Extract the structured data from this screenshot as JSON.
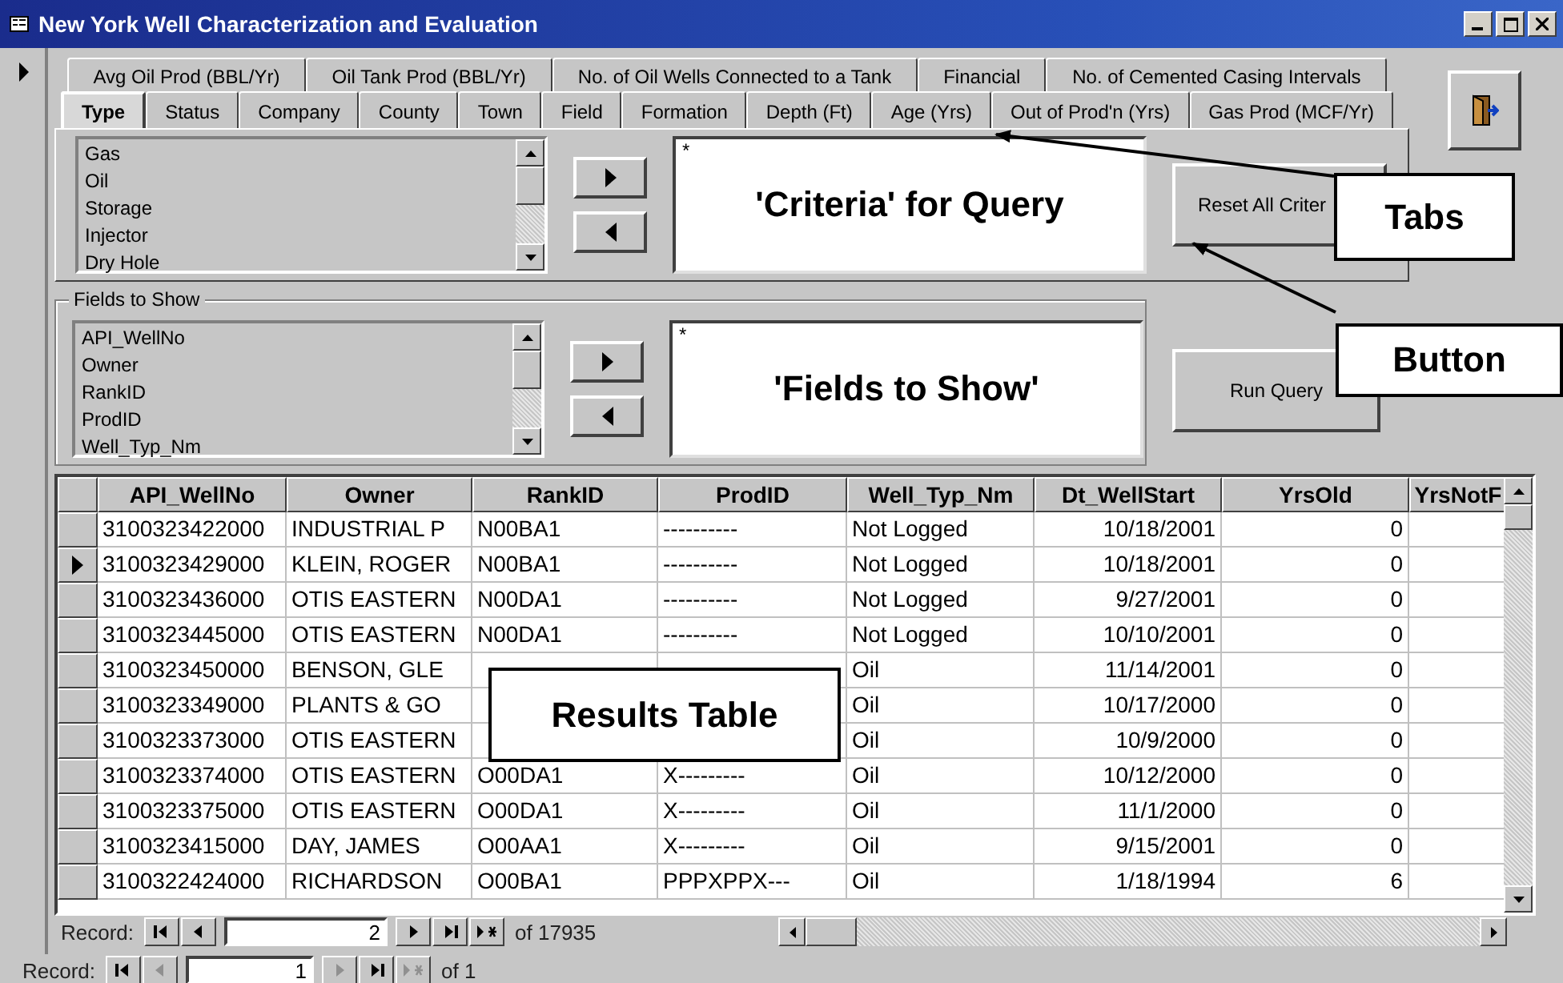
{
  "window": {
    "title": "New York Well Characterization and Evaluation"
  },
  "tabs_back": [
    {
      "label": "Avg Oil Prod (BBL/Yr)",
      "selected": false
    },
    {
      "label": "Oil Tank Prod (BBL/Yr)",
      "selected": false
    },
    {
      "label": "No. of Oil Wells Connected to a Tank",
      "selected": false
    },
    {
      "label": "Financial",
      "selected": false
    },
    {
      "label": "No. of Cemented Casing Intervals",
      "selected": false
    }
  ],
  "tabs_front": [
    {
      "label": "Type",
      "selected": true
    },
    {
      "label": "Status",
      "selected": false
    },
    {
      "label": "Company",
      "selected": false
    },
    {
      "label": "County",
      "selected": false
    },
    {
      "label": "Town",
      "selected": false
    },
    {
      "label": "Field",
      "selected": false
    },
    {
      "label": "Formation",
      "selected": false
    },
    {
      "label": "Depth (Ft)",
      "selected": false
    },
    {
      "label": "Age (Yrs)",
      "selected": false
    },
    {
      "label": "Out of Prod'n (Yrs)",
      "selected": false
    },
    {
      "label": "Gas Prod (MCF/Yr)",
      "selected": false
    }
  ],
  "criteria": {
    "items": [
      "Gas",
      "Oil",
      "Storage",
      "Injector",
      "Dry Hole"
    ],
    "box_value": "*",
    "box_caption": "'Criteria' for Query"
  },
  "reset_button": "Reset All Criter",
  "fields": {
    "title": "Fields to Show",
    "items": [
      "API_WellNo",
      "Owner",
      "RankID",
      "ProdID",
      "Well_Typ_Nm"
    ],
    "box_value": "*",
    "box_caption": "'Fields to Show'"
  },
  "run_button": "Run Query",
  "table": {
    "columns": [
      "API_WellNo",
      "Owner",
      "RankID",
      "ProdID",
      "Well_Typ_Nm",
      "Dt_WellStart",
      "YrsOld",
      "YrsNotF"
    ],
    "rows": [
      {
        "selected": false,
        "cells": [
          "3100323422000",
          "INDUSTRIAL P",
          "N00BA1",
          "----------",
          "Not Logged",
          "10/18/2001",
          "0"
        ]
      },
      {
        "selected": true,
        "cells": [
          "3100323429000",
          "KLEIN, ROGER",
          "N00BA1",
          "----------",
          "Not Logged",
          "10/18/2001",
          "0"
        ]
      },
      {
        "selected": false,
        "cells": [
          "3100323436000",
          "OTIS EASTERN",
          "N00DA1",
          "----------",
          "Not Logged",
          "9/27/2001",
          "0"
        ]
      },
      {
        "selected": false,
        "cells": [
          "3100323445000",
          "OTIS EASTERN",
          "N00DA1",
          "----------",
          "Not Logged",
          "10/10/2001",
          "0"
        ]
      },
      {
        "selected": false,
        "cells": [
          "3100323450000",
          "BENSON, GLE",
          null,
          null,
          "Oil",
          "11/14/2001",
          "0"
        ]
      },
      {
        "selected": false,
        "cells": [
          "3100323349000",
          "PLANTS & GO",
          null,
          null,
          "Oil",
          "10/17/2000",
          "0"
        ]
      },
      {
        "selected": false,
        "cells": [
          "3100323373000",
          "OTIS EASTERN",
          null,
          null,
          "Oil",
          "10/9/2000",
          "0"
        ]
      },
      {
        "selected": false,
        "cells": [
          "3100323374000",
          "OTIS EASTERN",
          "O00DA1",
          "X---------",
          "Oil",
          "10/12/2000",
          "0"
        ]
      },
      {
        "selected": false,
        "cells": [
          "3100323375000",
          "OTIS EASTERN",
          "O00DA1",
          "X---------",
          "Oil",
          "11/1/2000",
          "0"
        ]
      },
      {
        "selected": false,
        "cells": [
          "3100323415000",
          "DAY, JAMES",
          "O00AA1",
          "X---------",
          "Oil",
          "9/15/2001",
          "0"
        ]
      },
      {
        "selected": false,
        "cells": [
          "3100322424000",
          "RICHARDSON",
          "O00BA1",
          "PPPXPPX---",
          "Oil",
          "1/18/1994",
          "6"
        ]
      }
    ]
  },
  "subform_nav": {
    "label": "Record:",
    "current": "2",
    "total": "of 17935",
    "buttons": [
      {
        "kind": "first",
        "disabled": false
      },
      {
        "kind": "prev",
        "disabled": false
      },
      {
        "kind": "next",
        "disabled": false
      },
      {
        "kind": "last",
        "disabled": false
      },
      {
        "kind": "new",
        "disabled": false
      }
    ]
  },
  "form_nav": {
    "label": "Record:",
    "current": "1",
    "total": "of 1",
    "buttons": [
      {
        "kind": "first",
        "disabled": false
      },
      {
        "kind": "prev",
        "disabled": true
      },
      {
        "kind": "next",
        "disabled": true
      },
      {
        "kind": "last",
        "disabled": false
      },
      {
        "kind": "new",
        "disabled": true
      }
    ]
  },
  "callouts": [
    {
      "text": "Tabs"
    },
    {
      "text": "Button"
    },
    {
      "text": "Results Table"
    }
  ]
}
